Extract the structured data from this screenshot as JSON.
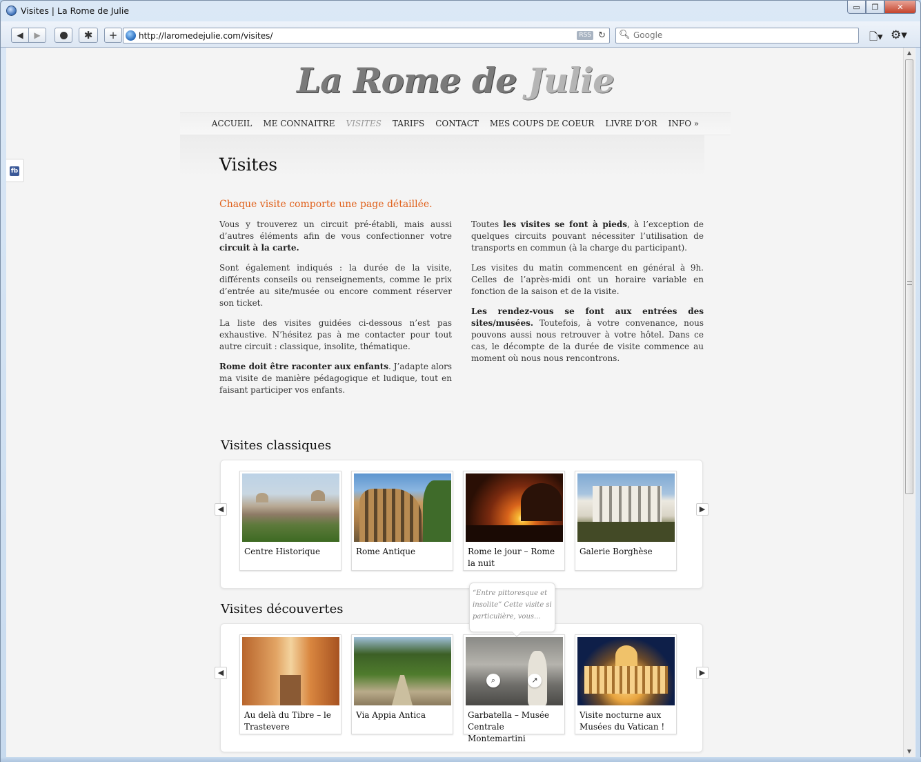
{
  "window": {
    "title": "Visites | La Rome de Julie",
    "minimize": "▭",
    "maximize": "❐",
    "close": "✕"
  },
  "toolbar": {
    "back": "◀",
    "forward": "▶",
    "address": "http://laromedejulie.com/visites/",
    "rss": "RSS",
    "reload": "↻",
    "search_placeholder": "Google",
    "add": "+",
    "new": "✱"
  },
  "site": {
    "logo_part1": "La Rome de ",
    "logo_part2": "Julie",
    "fb": "fb"
  },
  "nav": {
    "items": [
      {
        "label": "ACCUEIL"
      },
      {
        "label": "ME CONNAITRE"
      },
      {
        "label": "VISITES"
      },
      {
        "label": "TARIFS"
      },
      {
        "label": "CONTACT"
      },
      {
        "label": "MES COUPS DE COEUR"
      },
      {
        "label": "LIVRE D’OR"
      },
      {
        "label": "INFO »"
      }
    ]
  },
  "page": {
    "title": "Visites",
    "intro": "Chaque visite comporte une page détaillée.",
    "left": {
      "p1a": "Vous y trouverez un circuit pré-établi, mais aussi d’autres éléments afin de vous confectionner votre ",
      "p1b": "circuit à la carte.",
      "p2": "Sont également indiqués : la durée de la visite,  différents conseils ou renseignements, comme le prix d’entrée au site/musée ou encore comment réserver son ticket.",
      "p3": "La liste des visites guidées ci-dessous n’est pas exhaustive. N’hésitez pas à me contacter pour tout autre circuit : classique, insolite, thématique.",
      "p4a": "Rome doit être raconter aux enfants",
      "p4b": ". J’adapte alors ma visite de manière pédagogique et ludique, tout en faisant participer vos enfants."
    },
    "right": {
      "p1a": "Toutes ",
      "p1b": "les visites se font à pieds",
      "p1c": ", à l’exception de quelques circuits pouvant nécessiter l’utilisation de transports en commun (à la charge du participant).",
      "p2": "Les visites du matin commencent en général à 9h. Celles de l’après-midi ont un horaire variable en fonction de la saison et de la visite.",
      "p3a": "Les rendez-vous se font aux entrées des sites/musées.",
      "p3b": " Toutefois, à votre convenance, nous pouvons aussi nous retrouver à votre hôtel. Dans ce cas, le décompte de la durée de visite commence au moment où nous nous rencontrons."
    }
  },
  "sections": [
    {
      "title": "Visites classiques",
      "cards": [
        {
          "label": "Centre Historique"
        },
        {
          "label": "Rome Antique"
        },
        {
          "label": "Rome le jour – Rome la nuit"
        },
        {
          "label": "Galerie Borghèse"
        }
      ]
    },
    {
      "title": "Visites découvertes",
      "cards": [
        {
          "label": "Au delà du Tibre – le Trastevere"
        },
        {
          "label": "Via Appia Antica"
        },
        {
          "label": "Garbatella – Musée Centrale Montemartini"
        },
        {
          "label": "Visite nocturne aux Musées du Vatican !"
        }
      ]
    }
  ],
  "tooltip": {
    "text": "“Entre pittoresque et insolite”  Cette visite si particulière, vous..."
  },
  "carousel": {
    "prev": "◀",
    "next": "▶"
  }
}
